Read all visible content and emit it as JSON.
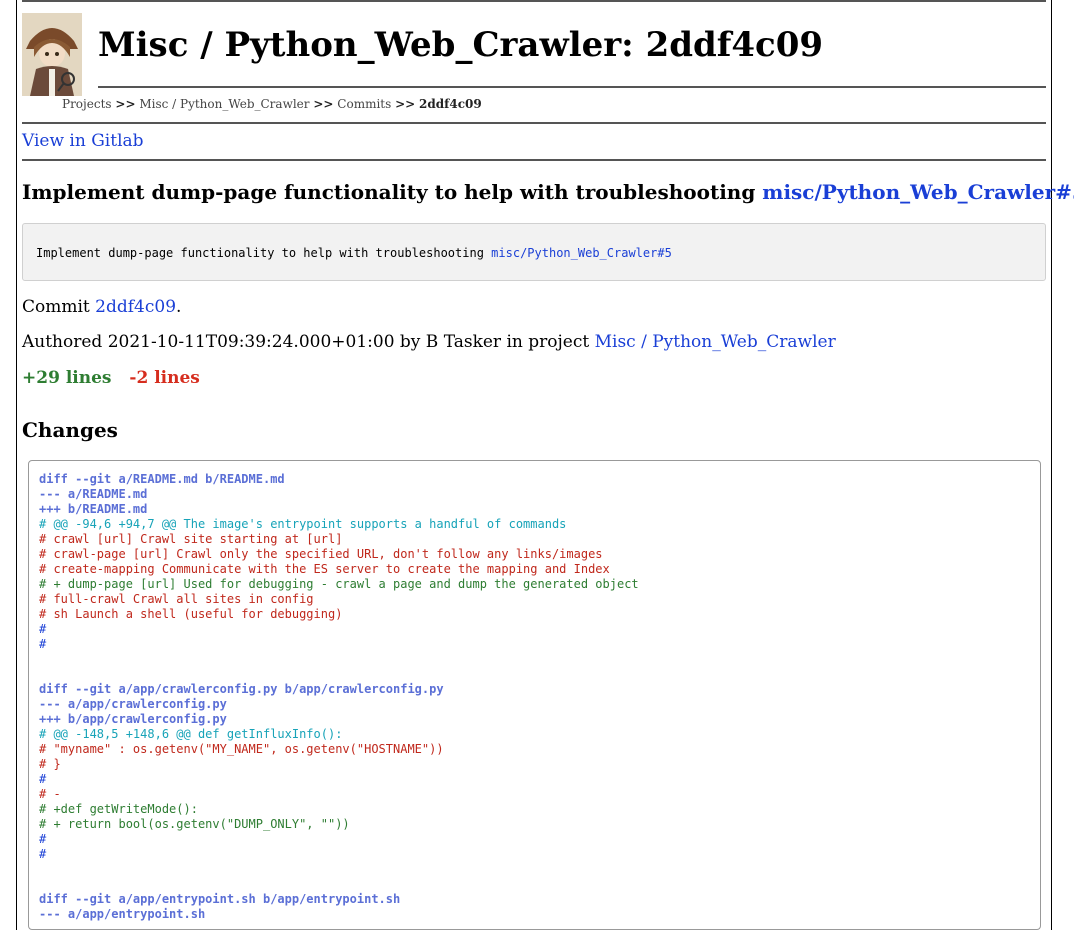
{
  "page": {
    "title": "Misc / Python_Web_Crawler: 2ddf4c09"
  },
  "breadcrumb": {
    "projects": "Projects",
    "sep": ">>",
    "project": "Misc / Python_Web_Crawler",
    "commits": "Commits",
    "current": "2ddf4c09"
  },
  "view_gitlab": "View in Gitlab",
  "commit": {
    "title_text": "Implement dump-page functionality to help with troubleshooting",
    "issue_ref": "misc/Python_Web_Crawler#5",
    "message_text": "Implement dump-page functionality to help with troubleshooting",
    "commit_label": "Commit",
    "commit_hash": "2ddf4c09",
    "commit_period": ".",
    "authored_prefix": "Authored 2021-10-11T09:39:24.000+01:00 by B Tasker in project",
    "project_link": "Misc / Python_Web_Crawler",
    "added": "+29 lines",
    "removed": "-2 lines"
  },
  "changes_heading": "Changes",
  "diff_lines": [
    {
      "t": "hdr",
      "s": "diff --git a/README.md b/README.md"
    },
    {
      "t": "hdr",
      "s": "--- a/README.md"
    },
    {
      "t": "hdr",
      "s": "+++ b/README.md"
    },
    {
      "t": "hunk",
      "s": "# @@ -94,6 +94,7 @@ The image's entrypoint supports a handful of commands"
    },
    {
      "t": "ctx",
      "s": "# crawl [url] Crawl site starting at [url]"
    },
    {
      "t": "ctx",
      "s": "# crawl-page [url] Crawl only the specified URL, don't follow any links/images"
    },
    {
      "t": "ctx",
      "s": "# create-mapping Communicate with the ES server to create the mapping and Index"
    },
    {
      "t": "add",
      "s": "# + dump-page [url] Used for debugging - crawl a page and dump the generated object"
    },
    {
      "t": "ctx",
      "s": "# full-crawl Crawl all sites in config"
    },
    {
      "t": "ctx",
      "s": "# sh Launch a shell (useful for debugging)"
    },
    {
      "t": "plain",
      "s": "#"
    },
    {
      "t": "plain",
      "s": "#"
    },
    {
      "t": "blank",
      "s": ""
    },
    {
      "t": "blank",
      "s": ""
    },
    {
      "t": "hdr",
      "s": "diff --git a/app/crawlerconfig.py b/app/crawlerconfig.py"
    },
    {
      "t": "hdr",
      "s": "--- a/app/crawlerconfig.py"
    },
    {
      "t": "hdr",
      "s": "+++ b/app/crawlerconfig.py"
    },
    {
      "t": "hunk",
      "s": "# @@ -148,5 +148,6 @@ def getInfluxInfo():"
    },
    {
      "t": "ctx",
      "s": "# \"myname\" : os.getenv(\"MY_NAME\", os.getenv(\"HOSTNAME\"))"
    },
    {
      "t": "ctx",
      "s": "# }"
    },
    {
      "t": "plain",
      "s": "#"
    },
    {
      "t": "ctx",
      "s": "# -"
    },
    {
      "t": "add",
      "s": "# +def getWriteMode():"
    },
    {
      "t": "add",
      "s": "# + return bool(os.getenv(\"DUMP_ONLY\", \"\"))"
    },
    {
      "t": "plain",
      "s": "#"
    },
    {
      "t": "plain",
      "s": "#"
    },
    {
      "t": "blank",
      "s": ""
    },
    {
      "t": "blank",
      "s": ""
    },
    {
      "t": "hdr",
      "s": "diff --git a/app/entrypoint.sh b/app/entrypoint.sh"
    },
    {
      "t": "hdr",
      "s": "--- a/app/entrypoint.sh"
    }
  ]
}
